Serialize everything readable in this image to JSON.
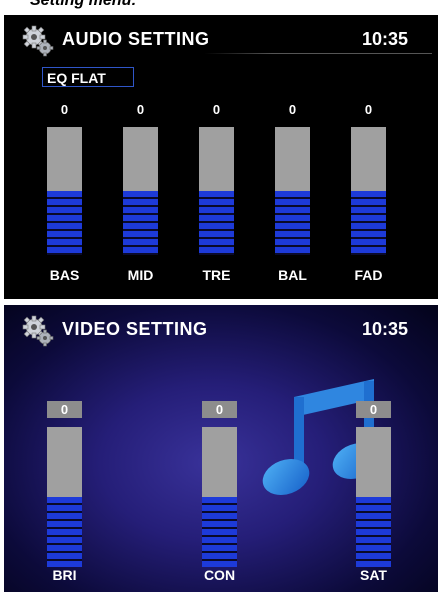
{
  "caption": "Setting menu:",
  "audio": {
    "title": "AUDIO SETTING",
    "time": "10:35",
    "preset": "EQ FLAT",
    "sliders": [
      {
        "label": "BAS",
        "value": "0",
        "level": 0.5
      },
      {
        "label": "MID",
        "value": "0",
        "level": 0.5
      },
      {
        "label": "TRE",
        "value": "0",
        "level": 0.5
      },
      {
        "label": "BAL",
        "value": "0",
        "level": 0.5
      },
      {
        "label": "FAD",
        "value": "0",
        "level": 0.5
      }
    ]
  },
  "video": {
    "title": "VIDEO SETTING",
    "time": "10:35",
    "sliders": [
      {
        "label": "BRI",
        "value": "0",
        "level": 0.5
      },
      {
        "label": "CON",
        "value": "0",
        "level": 0.5
      },
      {
        "label": "SAT",
        "value": "0",
        "level": 0.5
      }
    ]
  },
  "colors": {
    "accent": "#1d3ad9",
    "bar_track": "#a0a0a0",
    "preset_border": "#2f56c9"
  },
  "icons": [
    "gears-icon",
    "music-note-icon"
  ]
}
